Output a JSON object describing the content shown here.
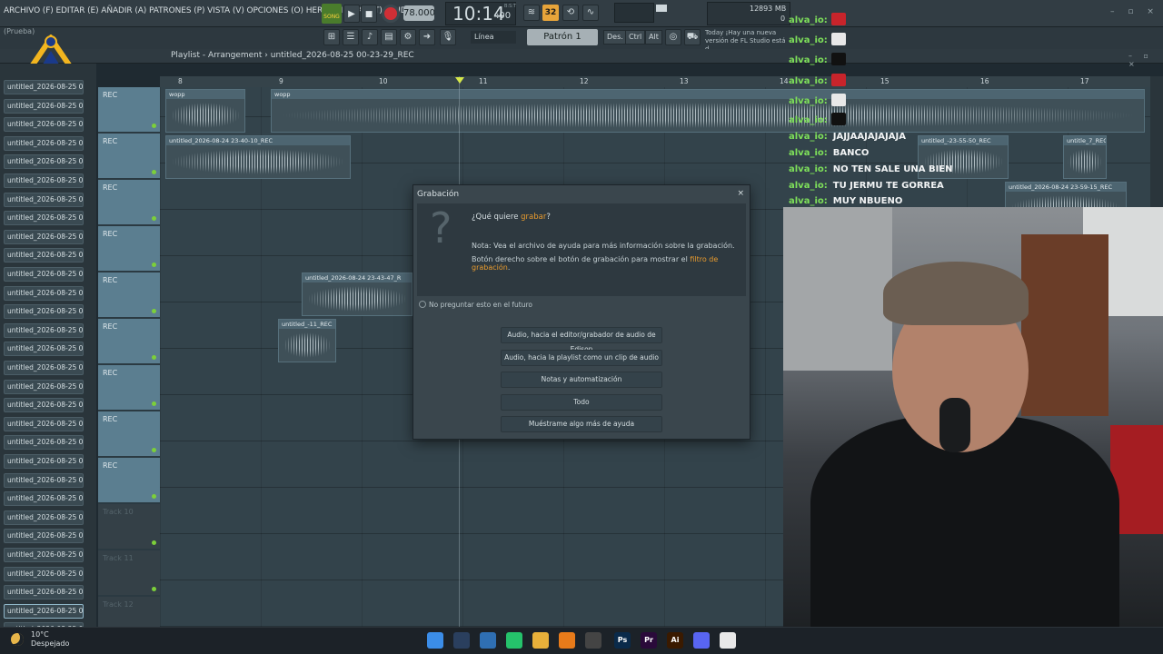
{
  "menu": "ARCHIVO (F) EDITAR (E) AÑADIR (A) PATRONES (P) VISTA (V) OPCIONES (O) HERRAMIENTAS (T) AYUDA",
  "transport": {
    "song_label": "SONG",
    "bpm": "78.000",
    "time": "10:14",
    "time_sub": ":00",
    "time_unit": "B:S:T",
    "pattern": "Patrón 1",
    "snap": "Línea",
    "cpu_value": "12",
    "ram_value": "893 MB",
    "ram_sub": "0"
  },
  "news": {
    "line1": "Today  ¡Hay una nueva",
    "line2": "versión de FL Studio está d"
  },
  "toolbar2": {
    "prueba": "(Prueba)",
    "btn_des": "Des.",
    "btn_ctrl": "Ctrl",
    "btn_alt": "Alt"
  },
  "playlist": {
    "title": "Playlist - Arrangement",
    "arrow": "›",
    "file": "untitled_2026-08-25 00-23-29_REC"
  },
  "picker_items": [
    "untitled_2026-08-25 00-...",
    "untitled_2026-08-25 00-...",
    "untitled_2026-08-25 00-...",
    "untitled_2026-08-25 00-...",
    "untitled_2026-08-25 00-...",
    "untitled_2026-08-25 00-...",
    "untitled_2026-08-25 00-...",
    "untitled_2026-08-25 00-...",
    "untitled_2026-08-25 00-...",
    "untitled_2026-08-25 00-...",
    "untitled_2026-08-25 00-...",
    "untitled_2026-08-25 00-...",
    "untitled_2026-08-25 00-...",
    "untitled_2026-08-25 00-...",
    "untitled_2026-08-25 00-...",
    "untitled_2026-08-25 00-...",
    "untitled_2026-08-25 00-...",
    "untitled_2026-08-25 00-...",
    "untitled_2026-08-25 00-...",
    "untitled_2026-08-25 00-...",
    "untitled_2026-08-25 00-...",
    "untitled_2026-08-25 00-...",
    "untitled_2026-08-25 00-...",
    "untitled_2026-08-25 00-...",
    "untitled_2026-08-25 00-...",
    "untitled_2026-08-25 00-...",
    "untitled_2026-08-25 00-...",
    "untitled_2026-08-25 00-...",
    "untitled_2026-08-25 00-...",
    "untitled_2026-08-25 00-..."
  ],
  "tracks": [
    "REC",
    "REC",
    "REC",
    "REC",
    "REC",
    "REC",
    "REC",
    "REC",
    "REC",
    "Track 10",
    "Track 11",
    "Track 12"
  ],
  "ruler": [
    "8",
    "9",
    "10",
    "11",
    "12",
    "13",
    "14",
    "15",
    "16",
    "17"
  ],
  "clips": [
    {
      "title": "wopp"
    },
    {
      "title": "wopp"
    },
    {
      "title": "untitled_2026-08-24 23-40-10_REC"
    },
    {
      "title": "untitled_2026-08-24 23-43-47_R"
    },
    {
      "title": "untitled_-11_REC"
    },
    {
      "title": "untitled_-23-55-50_REC"
    },
    {
      "title": "untitle_7_REC"
    },
    {
      "title": "untitled_2026-08-24 23-59-15_REC"
    }
  ],
  "dialog": {
    "title": "Grabación",
    "close": "×",
    "question_pre": "¿Qué quiere ",
    "question_hl": "grabar",
    "question_post": "?",
    "note1": "Nota: Vea el archivo de ayuda para más información sobre la grabación.",
    "note2_pre": "Botón derecho sobre el botón de grabación para mostrar el ",
    "note2_hl": "filtro de grabación",
    "note2_post": ".",
    "checkbox": "No preguntar esto en el futuro",
    "buttons": [
      "Audio, hacia el editor/grabador de audio de Edison",
      "Audio, hacia la playlist como un clip de audio",
      "Notas y automatización",
      "Todo",
      "Muéstrame algo más de ayuda"
    ]
  },
  "chat": [
    {
      "user": "alva_io:",
      "text": "",
      "badge": "#c8242b"
    },
    {
      "user": "alva_io:",
      "text": "",
      "badge": "#e8e8e8"
    },
    {
      "user": "alva_io:",
      "text": "",
      "badge": "#111111"
    },
    {
      "user": "alva_io:",
      "text": "",
      "badge": "#c8242b"
    },
    {
      "user": "alva_io:",
      "text": "",
      "badge": "#e8e8e8"
    },
    {
      "user": "alva_io:",
      "text": "",
      "badge": "#111111"
    },
    {
      "user": "alva_io:",
      "text": "JAJJAAJAJAJAJA"
    },
    {
      "user": "alva_io:",
      "text": "BANCO"
    },
    {
      "user": "alva_io:",
      "text": "NO TEN SALE UNA BIEN"
    },
    {
      "user": "alva_io:",
      "text": "TU JERMU TE GORREA"
    },
    {
      "user": "alva_io:",
      "text": "MUY NBUENO"
    }
  ],
  "weather": {
    "temp": "10°C",
    "desc": "Despejado"
  },
  "taskbar_icons": [
    "start-icon",
    "explorer-icon",
    "widgets-icon",
    "whatsapp-icon",
    "folder-icon",
    "fl-studio-icon",
    "obs-icon",
    "photoshop-icon",
    "premiere-icon",
    "illustrator-icon",
    "discord-icon",
    "chrome-icon"
  ],
  "taskbar_labels": {
    "photoshop": "Ps",
    "premiere": "Pr",
    "illustrator": "Ai"
  },
  "colors": {
    "accent": "#e89b2e",
    "rec": "#d02f36",
    "chat_name": "#7ee05a"
  }
}
